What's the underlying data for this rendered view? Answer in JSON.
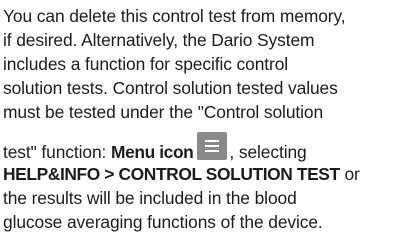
{
  "paragraph": {
    "line1": "You can delete this control test from memory,",
    "line2": "if desired. Alternatively, the Dario System",
    "line3": "includes a function for specific control",
    "line4": "solution tests. Control solution tested values",
    "line5": "must be tested under the \"Control solution",
    "line6_text": "test\" function: ",
    "line6_bold": "Menu icon",
    "menu_icon": "hamburger-menu-icon",
    "line6_after": ", selecting",
    "line7_bold": "HELP&INFO > CONTROL SOLUTION TEST",
    "line7_after": " or",
    "line8": "the results will be included in the blood",
    "line9": "glucose averaging functions of the device."
  },
  "colors": {
    "text": "#1c1c1c",
    "icon_background": "#8a8a8a",
    "icon_glyph": "#ffffff"
  }
}
